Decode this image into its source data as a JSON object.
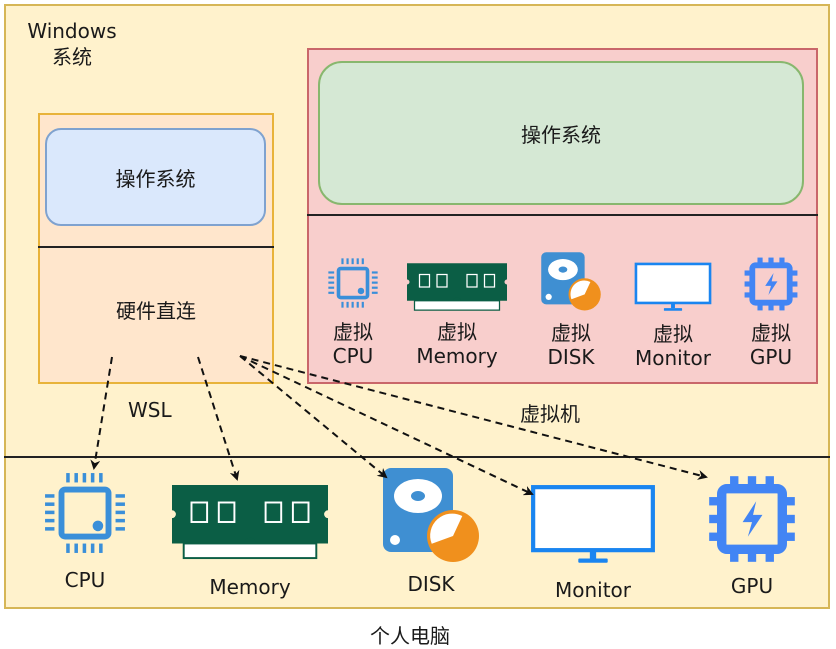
{
  "diagram": {
    "windows_label_line1": "Windows",
    "windows_label_line2": "系统",
    "wsl": {
      "os_label": "操作系统",
      "hw_direct_label": "硬件直连",
      "caption": "WSL"
    },
    "vm": {
      "os_label": "操作系统",
      "caption": "虚拟机",
      "virtual_prefix": "虚拟",
      "devices": [
        {
          "name": "CPU",
          "icon": "cpu-icon"
        },
        {
          "name": "Memory",
          "icon": "memory-icon"
        },
        {
          "name": "DISK",
          "icon": "disk-icon"
        },
        {
          "name": "Monitor",
          "icon": "monitor-icon"
        },
        {
          "name": "GPU",
          "icon": "gpu-icon"
        }
      ]
    },
    "pc": {
      "caption": "个人电脑",
      "devices": [
        {
          "name": "CPU",
          "icon": "cpu-icon"
        },
        {
          "name": "Memory",
          "icon": "memory-icon"
        },
        {
          "name": "DISK",
          "icon": "disk-icon"
        },
        {
          "name": "Monitor",
          "icon": "monitor-icon"
        },
        {
          "name": "GPU",
          "icon": "gpu-icon"
        }
      ]
    },
    "edges": [
      {
        "from": "硬件直连",
        "to": "CPU",
        "style": "dashed"
      },
      {
        "from": "硬件直连",
        "to": "Memory",
        "style": "dashed"
      },
      {
        "from": "硬件直连",
        "to": "DISK",
        "style": "dashed"
      },
      {
        "from": "硬件直连",
        "to": "Monitor",
        "style": "dashed"
      },
      {
        "from": "硬件直连",
        "to": "GPU",
        "style": "dashed"
      }
    ],
    "colors": {
      "outer_fill": "#fff2cc",
      "outer_stroke": "#d6b656",
      "wsl_fill": "#ffe6cc",
      "wsl_stroke": "#e8b33a",
      "vm_fill": "#f8cecc",
      "vm_stroke": "#c9676a",
      "os_blue_fill": "#dae8fc",
      "os_green_fill": "#d5e8d4",
      "cpu_blue": "#3a8fd9",
      "memory_green": "#0b5e45",
      "disk_blue": "#3f8fd2",
      "disk_orange": "#f0901d",
      "monitor_blue": "#1a85f0",
      "gpu_blue": "#4285f4"
    }
  }
}
